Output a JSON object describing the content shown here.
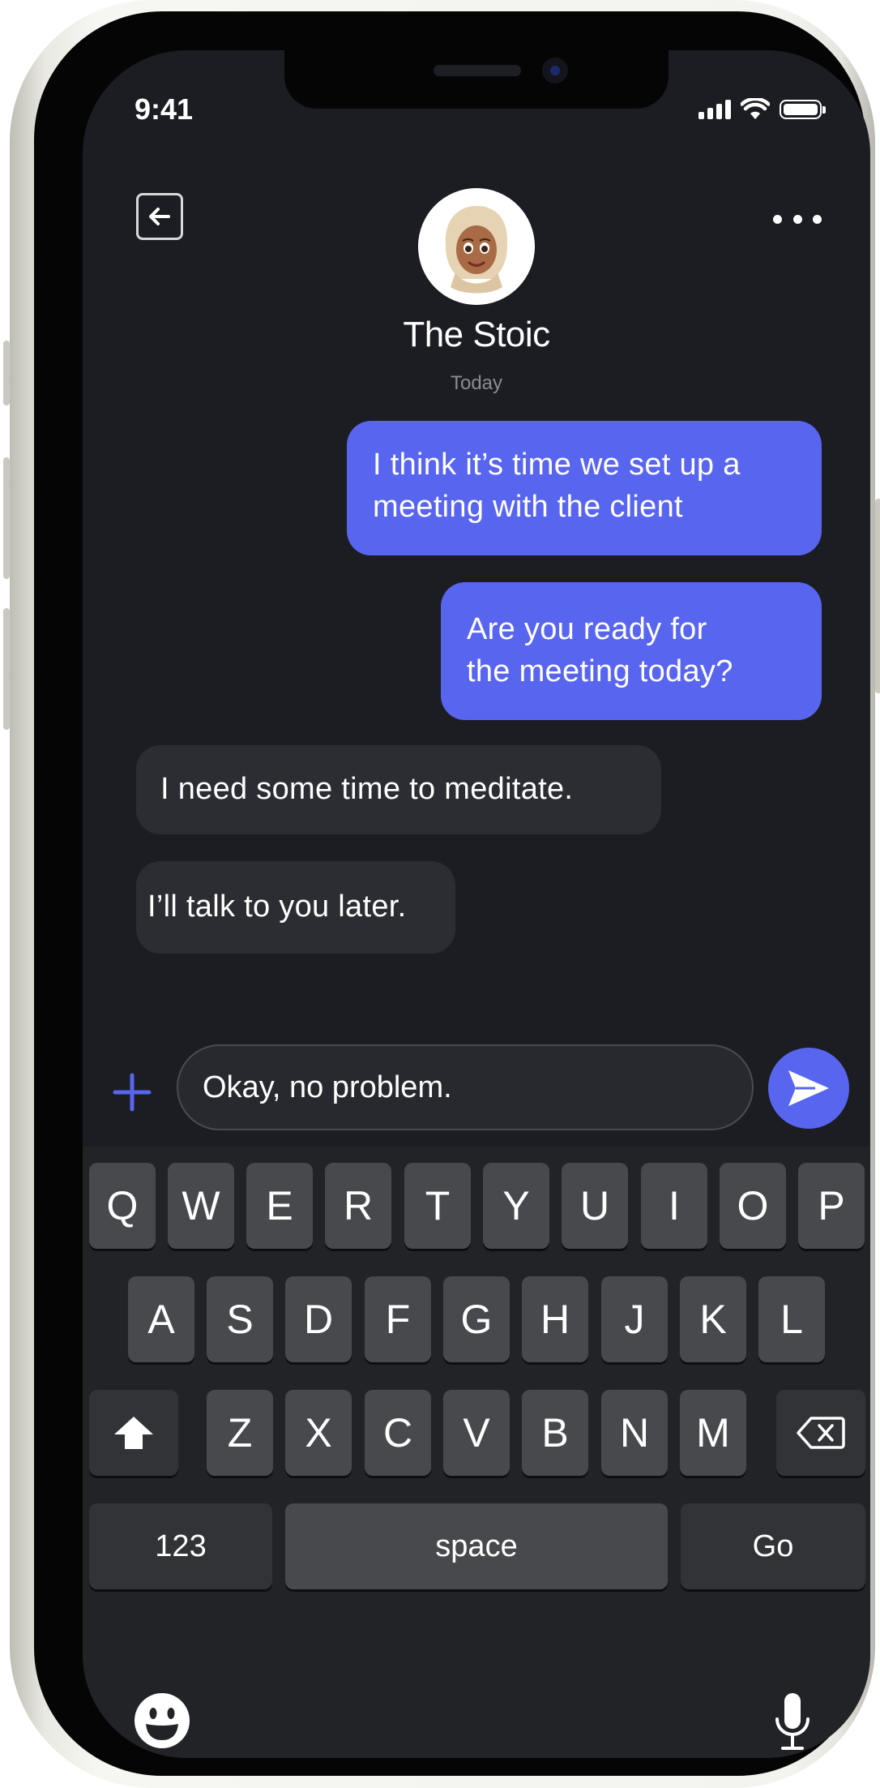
{
  "status_bar": {
    "time": "9:41"
  },
  "header": {
    "back_icon": "arrow-left-icon",
    "more_icon": "ellipsis-icon",
    "contact_name": "The Stoic",
    "date_label": "Today"
  },
  "messages": [
    {
      "direction": "outgoing",
      "lines": [
        "I think it’s time we set up a",
        "meeting with the client"
      ]
    },
    {
      "direction": "outgoing",
      "lines": [
        "Are you ready for",
        "the meeting today?"
      ]
    },
    {
      "direction": "incoming",
      "lines": [
        "I need some time to meditate."
      ]
    },
    {
      "direction": "incoming",
      "lines": [
        "I’ll talk to you later."
      ]
    }
  ],
  "composer": {
    "value": "Okay, no problem.",
    "plus_icon": "plus-icon",
    "send_icon": "send-icon"
  },
  "keyboard": {
    "row1": [
      "Q",
      "W",
      "E",
      "R",
      "T",
      "Y",
      "U",
      "I",
      "O",
      "P"
    ],
    "row2": [
      "A",
      "S",
      "D",
      "F",
      "G",
      "H",
      "J",
      "K",
      "L"
    ],
    "row3": [
      "Z",
      "X",
      "C",
      "V",
      "B",
      "N",
      "M"
    ],
    "numbers_label": "123",
    "space_label": "space",
    "go_label": "Go",
    "shift_icon": "shift-icon",
    "delete_icon": "backspace-icon",
    "emoji_icon": "emoji-icon",
    "mic_icon": "microphone-icon"
  },
  "colors": {
    "accent": "#5865ef",
    "background": "#1c1d23",
    "incoming_bubble": "#2c2d33"
  }
}
